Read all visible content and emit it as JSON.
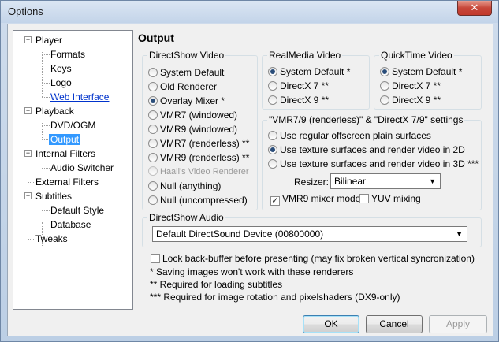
{
  "window": {
    "title": "Options",
    "close_glyph": "✕"
  },
  "tree": {
    "items": [
      {
        "label": "Player"
      },
      {
        "label": "Formats"
      },
      {
        "label": "Keys"
      },
      {
        "label": "Logo"
      },
      {
        "label": "Web Interface"
      },
      {
        "label": "Playback"
      },
      {
        "label": "DVD/OGM"
      },
      {
        "label": "Output"
      },
      {
        "label": "Internal Filters"
      },
      {
        "label": "Audio Switcher"
      },
      {
        "label": "External Filters"
      },
      {
        "label": "Subtitles"
      },
      {
        "label": "Default Style"
      },
      {
        "label": "Database"
      },
      {
        "label": "Tweaks"
      }
    ],
    "expander_glyph": "−"
  },
  "page": {
    "title": "Output"
  },
  "directshow_video": {
    "title": "DirectShow Video",
    "options": [
      "System Default",
      "Old Renderer",
      "Overlay Mixer *",
      "VMR7 (windowed)",
      "VMR9 (windowed)",
      "VMR7 (renderless) **",
      "VMR9 (renderless) **",
      "Haali's Video Renderer",
      "Null (anything)",
      "Null (uncompressed)"
    ]
  },
  "realmedia_video": {
    "title": "RealMedia Video",
    "options": [
      "System Default *",
      "DirectX 7 **",
      "DirectX 9 **"
    ]
  },
  "quicktime_video": {
    "title": "QuickTime Video",
    "options": [
      "System Default *",
      "DirectX 7 **",
      "DirectX 9 **"
    ]
  },
  "vmr_settings": {
    "title": "\"VMR7/9 (renderless)\" & \"DirectX 7/9\" settings",
    "options": [
      "Use regular offscreen plain surfaces",
      "Use texture surfaces and render video in 2D",
      "Use texture surfaces and render video in 3D ***"
    ],
    "resizer_label": "Resizer:",
    "resizer_value": "Bilinear",
    "vmr9_mixer_label": "VMR9 mixer mode",
    "vmr9_mixer_check": "✓",
    "yuv_mixing_label": "YUV mixing"
  },
  "directshow_audio": {
    "title": "DirectShow Audio",
    "device": "Default DirectSound Device (00800000)"
  },
  "lock_backbuffer_label": "Lock back-buffer before presenting (may fix broken vertical syncronization)",
  "notes": [
    "* Saving images won't work with these renderers",
    "** Required for loading subtitles",
    "*** Required for image rotation and pixelshaders (DX9-only)"
  ],
  "dropdown_glyph": "▼",
  "buttons": {
    "ok": "OK",
    "cancel": "Cancel",
    "apply": "Apply"
  }
}
